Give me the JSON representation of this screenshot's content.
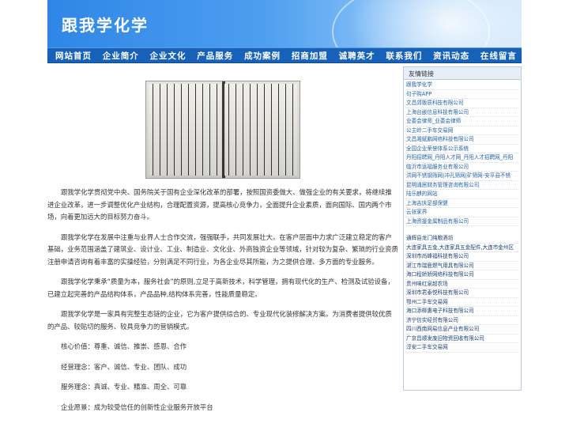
{
  "header": {
    "title": "跟我学化学"
  },
  "nav": [
    "网站首页",
    "企业简介",
    "企业文化",
    "产品服务",
    "成功案例",
    "招商加盟",
    "诚聘英才",
    "联系我们",
    "资讯动态",
    "在线留言"
  ],
  "article": {
    "paragraphs": [
      "跟我学化学贯彻党中央、国务院关于国有企业深化改革的部署，按照国资委做大、做强企业的有关要求，将继续推进企业改革，进一步调整优化产业结构，合理配置资源，提高核心竞争力，全面提升企业素质，面向国际、国内两个市场，向着更加远大的目标努力奋斗。",
      "跟我学化学在发展中注重与业界人士合作交流，强强联手，共同发展壮大。在客户层面中力求广泛建立稳定的客户基础，业务范围涵盖了建筑业、设计业、工业、制造业、文化业、外商独资企业等领域，针对较为复杂、繁琐的行业资质注册申请咨询有着丰富的实操经验，分别满足不同行业，为各企业尽其所能，为之提供合理、多方面的专业服务。",
      "跟我学化学秉承“质量为本，服务社会”的原则,立足于高新技术，科学管理，拥有现代化的生产、检测及试验设备，已建立起完善的产品结构体系，产品品种,结构体系完善，性能质量稳定。",
      "跟我学化学是一家具有完整生态链的企业，它为客户提供综合的、专业现代化装修解决方案。为消费者提供较优质的产品、较贴切的服务、较具竞争力的营销模式。",
      "核心价值：尊重、诚信、推崇、感恩、合作",
      "经营理念：客户、诚信、专业、团队、成功",
      "服务理念：真诚、专业、精准、周全、可靠",
      "企业愿景：成为较受信任的创新性企业服务开放平台"
    ]
  },
  "sidebar": {
    "title": "友情链接",
    "links": [
      "跟我学化学",
      "句子购APP",
      "文昌郊贩质科技有限公司",
      "上海台嵌信息科技有限公司",
      "业委会律师_业委会律师",
      "公主岭二手车交易网",
      "文昌湘斌鹏网络科技有限公司",
      "全国企业荣誉体系公示系统",
      "丹阳招聘网_丹阳人才网_丹阳人才招聘网_丹阳",
      "临沂市运福服务业有限公司",
      "洪网不锈钢筛网|冲孔筛网|矿筛网-安平县不锈",
      "昆明涌居财务管理咨询有限公司",
      "陆乐麒的网站",
      "上海吉庆足部保健",
      "云张家界",
      "上海资援金属制品有限公司",
      "",
      "通辉县龙门纯粮酒坊",
      "大连家具五金,大连家具五金配件,大连市金州区",
      "深圳市尚峰福科技有限公司",
      "湛江市瑞鹿燃气用具有限公司",
      "海口程娇娇网络科技有限公司",
      "贵州味红泉超农场",
      "深圳市君泰悦科技有限公司",
      "鄂州二手车交易网",
      "海口添柳惠电子科技有限公司",
      "济宁信实经贸有限公司",
      "四川西南网易信息产业有限公司",
      "广京昌顺发废旧物资回收有限公司",
      "淳安二手车交易网"
    ]
  },
  "colors": {
    "nav_bg": "#1762b8",
    "header_start": "#2f86e6",
    "link": "#2261a8"
  }
}
